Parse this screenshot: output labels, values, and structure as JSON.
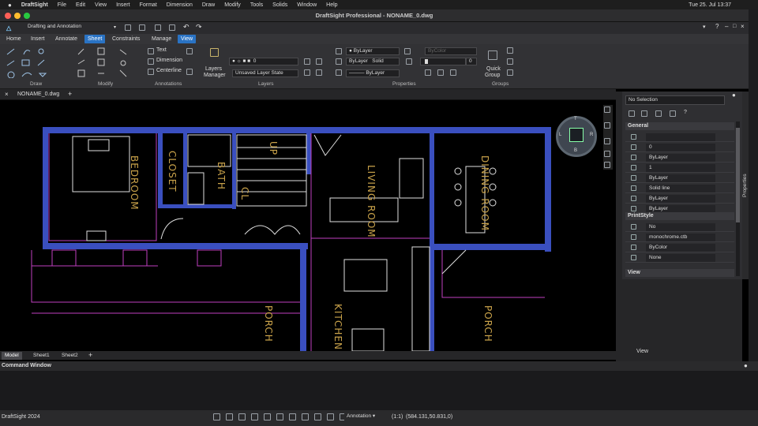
{
  "os_menubar": {
    "app_name": "DraftSight",
    "items": [
      "File",
      "Edit",
      "View",
      "Insert",
      "Format",
      "Dimension",
      "Draw",
      "Modify",
      "Tools",
      "Solids",
      "Window",
      "Help"
    ],
    "clock": "Tue 25. Jul  13:37"
  },
  "window": {
    "title": "DraftSight Professional - NONAME_0.dwg"
  },
  "toolbar": {
    "workspace": "Drafting and Annotation"
  },
  "ribbon_tabs": [
    "Home",
    "Insert",
    "Annotate",
    "Sheet",
    "Constraints",
    "Manage",
    "View"
  ],
  "ribbon_groups": {
    "draw": "Draw",
    "modify": "Modify",
    "annotations": "Annotations",
    "layers": "Layers",
    "properties": "Properties",
    "groups": "Groups"
  },
  "annotations": {
    "text": "Text",
    "dimension": "Dimension",
    "centerline": "Centerline"
  },
  "layers": {
    "manager_line1": "Layers",
    "manager_line2": "Manager",
    "current_layer": "0",
    "layer_state": "Unsaved Layer State"
  },
  "properties_ribbon": {
    "color": "ByLayer",
    "linestyle_layer": "ByLayer",
    "linestyle_name": "Solid",
    "lineweight": "ByLayer",
    "bycolor": "ByColor",
    "transparency": "0"
  },
  "quick_group": {
    "line1": "Quick",
    "line2": "Group"
  },
  "document_tab": "NONAME_0.dwg",
  "canvas": {
    "room_labels": [
      "BEDROOM",
      "CLOSET",
      "BATH",
      "CL",
      "UP",
      "LIVING ROOM",
      "DINING ROOM",
      "PORCH",
      "KITCHEN",
      "PORCH"
    ],
    "viewcube_labels": {
      "top": "T",
      "right": "R",
      "bottom": "B",
      "left": "L"
    }
  },
  "layout_tabs": [
    "Model",
    "Sheet1",
    "Sheet2"
  ],
  "properties_panel": {
    "selection": "No Selection",
    "general_title": "General",
    "general_rows": [
      "",
      "0",
      "ByLayer",
      "1",
      "ByLayer",
      "Solid line",
      "ByLayer",
      "ByLayer"
    ],
    "printstyle_title": "PrintStyle",
    "printstyle_rows": [
      "No",
      "monochrome.ctb",
      "ByColor",
      "None"
    ],
    "view_title": "View",
    "side_tab": "Properties",
    "lower_title": "View"
  },
  "command_window": {
    "title": "Command Window"
  },
  "status": {
    "version": "DraftSight 2024",
    "annotation": "Annotation",
    "scale": "(1:1)",
    "coordinates": "(584.131,50.831,0)"
  }
}
